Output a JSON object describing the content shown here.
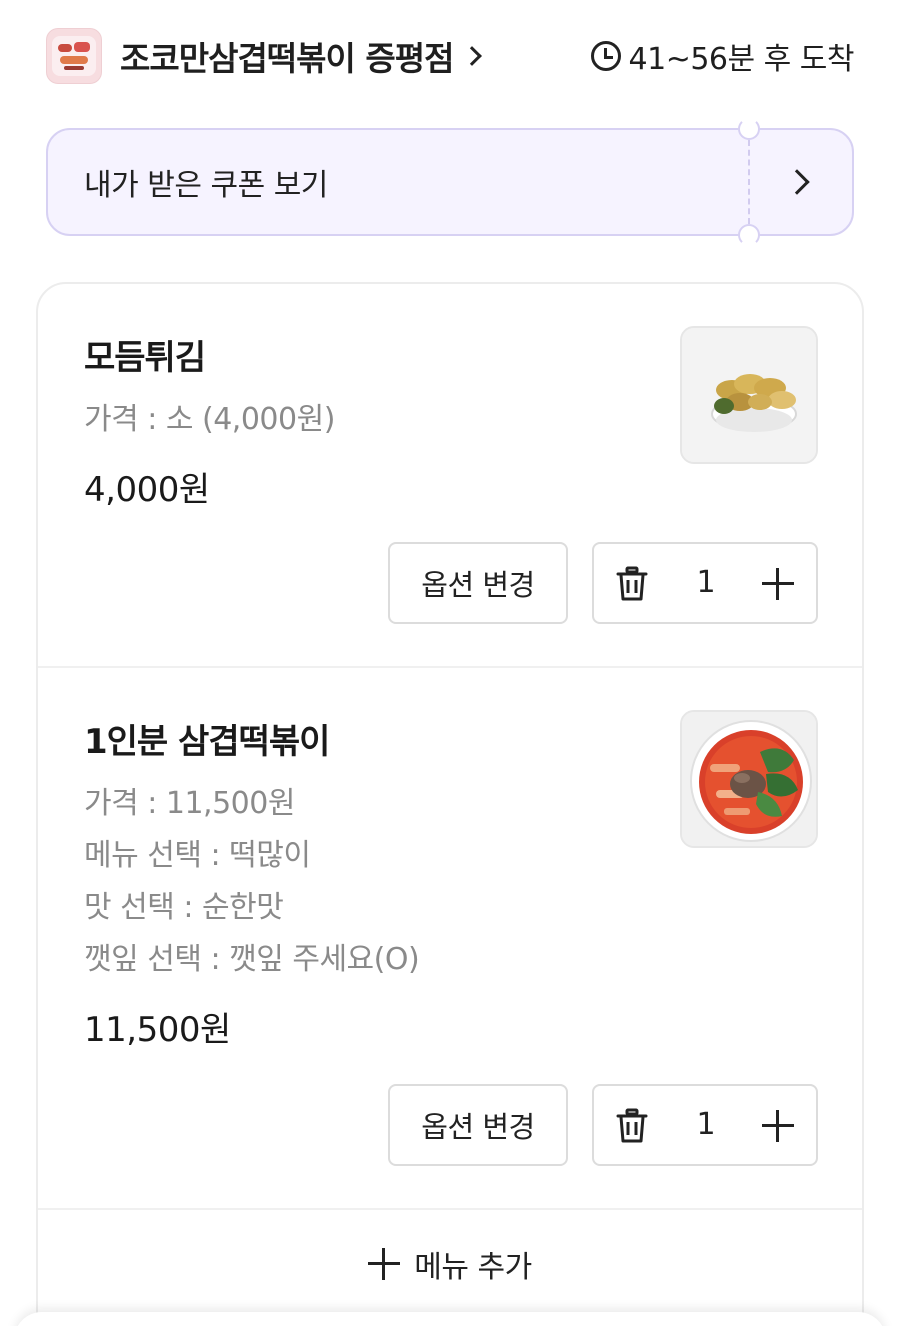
{
  "header": {
    "store_name": "조코만삼겹떡볶이 증평점",
    "eta": "41~56분 후 도착",
    "logo_icon": "store-logo"
  },
  "coupon": {
    "label": "내가 받은 쿠폰 보기"
  },
  "cart": {
    "items": [
      {
        "name": "모듬튀김",
        "options": [
          "가격 : 소 (4,000원)"
        ],
        "price": "4,000원",
        "quantity": "1",
        "option_button": "옵션 변경",
        "image": "fried-assortment-photo"
      },
      {
        "name": "1인분 삼겹떡볶이",
        "options": [
          "가격 : 11,500원",
          "메뉴 선택 : 떡많이",
          "맛 선택 : 순한맛",
          "깻잎 선택 : 깻잎 주세요(O)"
        ],
        "price": "11,500원",
        "quantity": "1",
        "option_button": "옵션 변경",
        "image": "tteokbokki-photo"
      }
    ],
    "add_menu_label": "메뉴 추가"
  },
  "colors": {
    "coupon_bg": "#f6f3ff",
    "coupon_border": "#d7d1f3",
    "text_primary": "#1a1a1a",
    "text_secondary": "#8a8a8a"
  }
}
